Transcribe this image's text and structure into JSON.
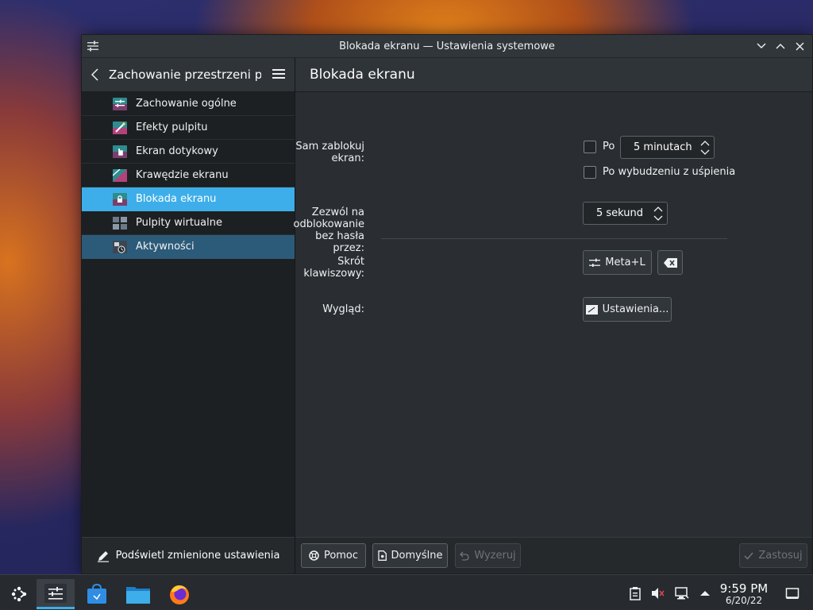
{
  "window": {
    "title": "Blokada ekranu — Ustawienia systemowe"
  },
  "sidebar": {
    "header_title": "Zachowanie przestrzeni p...",
    "items": [
      {
        "label": "Zachowanie ogólne",
        "icon": "general-behavior-icon"
      },
      {
        "label": "Efekty pulpitu",
        "icon": "desktop-effects-icon"
      },
      {
        "label": "Ekran dotykowy",
        "icon": "touchscreen-icon"
      },
      {
        "label": "Krawędzie ekranu",
        "icon": "screen-edges-icon"
      },
      {
        "label": "Blokada ekranu",
        "icon": "screen-lock-icon"
      },
      {
        "label": "Pulpity wirtualne",
        "icon": "virtual-desktops-icon"
      },
      {
        "label": "Aktywności",
        "icon": "activities-icon"
      }
    ],
    "footer_label": "Podświetl zmienione ustawienia"
  },
  "content": {
    "title": "Blokada ekranu",
    "auto_lock_label": "Sam zablokuj ekran:",
    "after_label": "Po",
    "after_value": "5 minutach",
    "after_wake_label": "Po wybudzeniu z uśpienia",
    "unlock_label": "Zezwól na odblokowanie bez hasła przez:",
    "unlock_value": "5 sekund",
    "shortcut_label": "Skrót klawiszowy:",
    "shortcut_value": "Meta+L",
    "appearance_label": "Wygląd:",
    "appearance_button": "Ustawienia..."
  },
  "buttons": {
    "help": "Pomoc",
    "defaults": "Domyślne",
    "reset": "Wyzeruj",
    "apply": "Zastosuj"
  },
  "taskbar": {
    "time": "9:59 PM",
    "date": "6/20/22"
  },
  "colors": {
    "accent": "#3daee9",
    "window_bg": "#2a2e32",
    "sidebar_bg": "#1d2023"
  }
}
